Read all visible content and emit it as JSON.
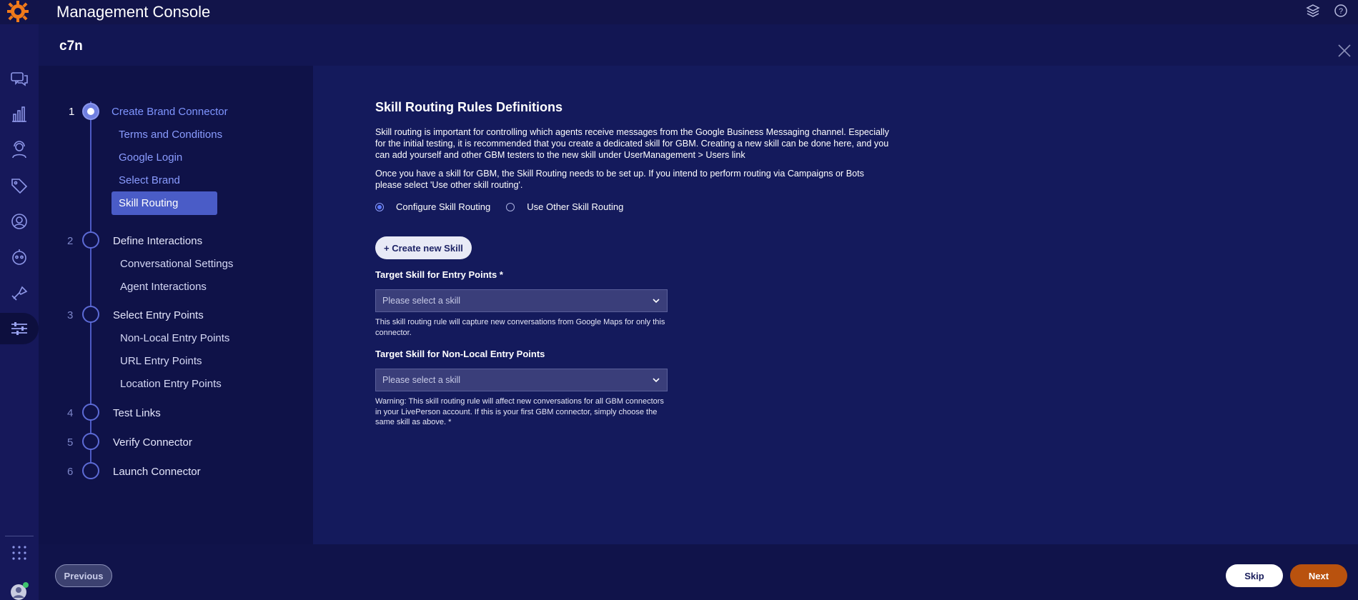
{
  "app": {
    "title": "Management Console",
    "connector_name": "c7n"
  },
  "colors": {
    "background": "#10134a",
    "accent": "#4a5cc7",
    "primary_button": "#b9520e",
    "logo": "#f07a1a"
  },
  "rail": {
    "items": [
      {
        "icon": "chat-icon"
      },
      {
        "icon": "analytics-icon"
      },
      {
        "icon": "agent-icon"
      },
      {
        "icon": "tag-icon"
      },
      {
        "icon": "user-icon"
      },
      {
        "icon": "bot-icon"
      },
      {
        "icon": "automation-icon"
      },
      {
        "icon": "settings-sliders-icon",
        "active": true
      },
      {
        "icon": "apps-grid-icon"
      },
      {
        "icon": "avatar-icon"
      }
    ]
  },
  "stepper": {
    "steps": [
      {
        "number": "1",
        "title": "Create Brand Connector",
        "active": true,
        "subs": [
          "Terms and Conditions",
          "Google Login",
          "Select Brand",
          "Skill Routing"
        ]
      },
      {
        "number": "2",
        "title": "Define Interactions",
        "subs": [
          "Conversational Settings",
          "Agent Interactions"
        ]
      },
      {
        "number": "3",
        "title": "Select Entry Points",
        "subs": [
          "Non-Local Entry Points",
          "URL Entry Points",
          "Location Entry Points"
        ]
      },
      {
        "number": "4",
        "title": "Test Links",
        "subs": []
      },
      {
        "number": "5",
        "title": "Verify Connector",
        "subs": []
      },
      {
        "number": "6",
        "title": "Launch Connector",
        "subs": []
      }
    ],
    "selected_sub": "Skill Routing"
  },
  "main": {
    "title": "Skill Routing Rules Definitions",
    "paragraph1": "Skill routing is important for controlling which agents receive messages from the Google Business Messaging channel. Especially for the initial testing, it is recommended that you create a dedicated skill for GBM. Creating a new skill can be done here, and you can add yourself and other GBM testers to the new skill under UserManagement > Users link",
    "paragraph2": "Once you have a skill for GBM, the Skill Routing needs to be set up. If you intend to perform routing via Campaigns or Bots please select 'Use other skill routing'.",
    "radio_options": [
      {
        "label": "Configure Skill Routing",
        "selected": true
      },
      {
        "label": "Use Other Skill Routing",
        "selected": false
      }
    ],
    "create_button": "+ Create new Skill",
    "field1": {
      "label": "Target Skill for Entry Points *",
      "placeholder": "Please select a skill",
      "helper": "This skill routing rule will capture new conversations from Google Maps for only this connector."
    },
    "field2": {
      "label": "Target Skill for Non-Local Entry Points",
      "placeholder": "Please select a skill",
      "helper": "Warning: This skill routing rule will affect new conversations for all GBM connectors in your LivePerson account. If this is your first GBM connector, simply choose the same skill as above. *"
    }
  },
  "footer": {
    "previous": "Previous",
    "skip": "Skip",
    "next": "Next"
  }
}
